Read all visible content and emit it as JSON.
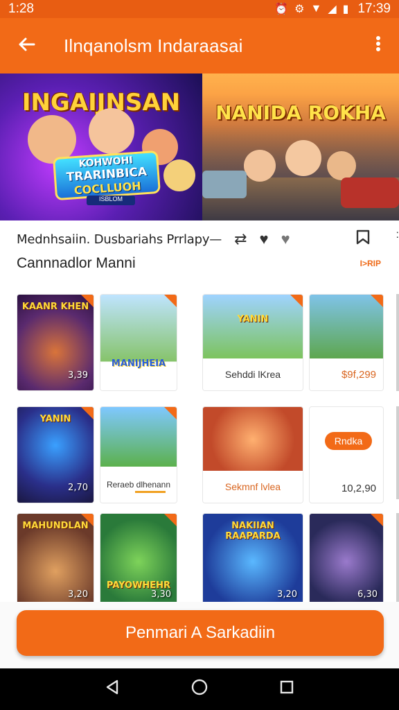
{
  "status": {
    "left_time": "1:28",
    "right_time": "17:39",
    "icons": [
      "alarm-icon",
      "vibrate-icon",
      "wifi-icon",
      "signal-icon",
      "battery-icon"
    ]
  },
  "appbar": {
    "title": "Ilnqanolsm Indaraasai",
    "back_icon": "arrow-left-icon",
    "menu_icon": "more-vert-icon",
    "color": "#f26a17"
  },
  "banner": [
    {
      "title": "INGAIJNSAN",
      "logo_lines": [
        "KOHWOHI",
        "TRARINBICA",
        "COCLLUOH"
      ],
      "logo_small": "ISBLOM"
    },
    {
      "title": "NANIDA ROKHA"
    }
  ],
  "infobar": {
    "text": "Mednhsaiin. Dusbariahs   Prrlapy—",
    "icons": [
      "share-icon",
      "heart-icon",
      "heart-icon",
      "bookmark-icon"
    ]
  },
  "section": {
    "title": "Cannnadlor Manni",
    "link": "I>RIP"
  },
  "grid": {
    "row1": [
      {
        "art_title": "KAANR KHEN",
        "price": "3,39"
      },
      {
        "art_title": "MANIJHEIA",
        "label": ""
      },
      {
        "art_title": "YANIN",
        "label": "Sehddi lKrea"
      },
      {
        "art_title": "",
        "label": "$9f,299"
      }
    ],
    "row2": [
      {
        "art_title": "YANIN",
        "price": "2,70"
      },
      {
        "art_title": "",
        "label": "Reraeb dlhenann"
      },
      {
        "art_title": "",
        "label": "Sekmnf lvlea"
      },
      {
        "pill": "Rndka",
        "price": "10,2,90"
      }
    ],
    "row3": [
      {
        "art_title": "MAHUNDLAN",
        "price": "3,20"
      },
      {
        "art_title": "PAYOWHEHR",
        "price": "3,30"
      },
      {
        "art_title": "NAKIIAN RAAPARDA",
        "price": "3,20"
      },
      {
        "art_title": "",
        "price": "6,30"
      }
    ]
  },
  "cta": {
    "label": "Penmari A Sarkadiin"
  },
  "navbar": {
    "icons": [
      "back-triangle-icon",
      "home-circle-icon",
      "recents-square-icon"
    ]
  }
}
